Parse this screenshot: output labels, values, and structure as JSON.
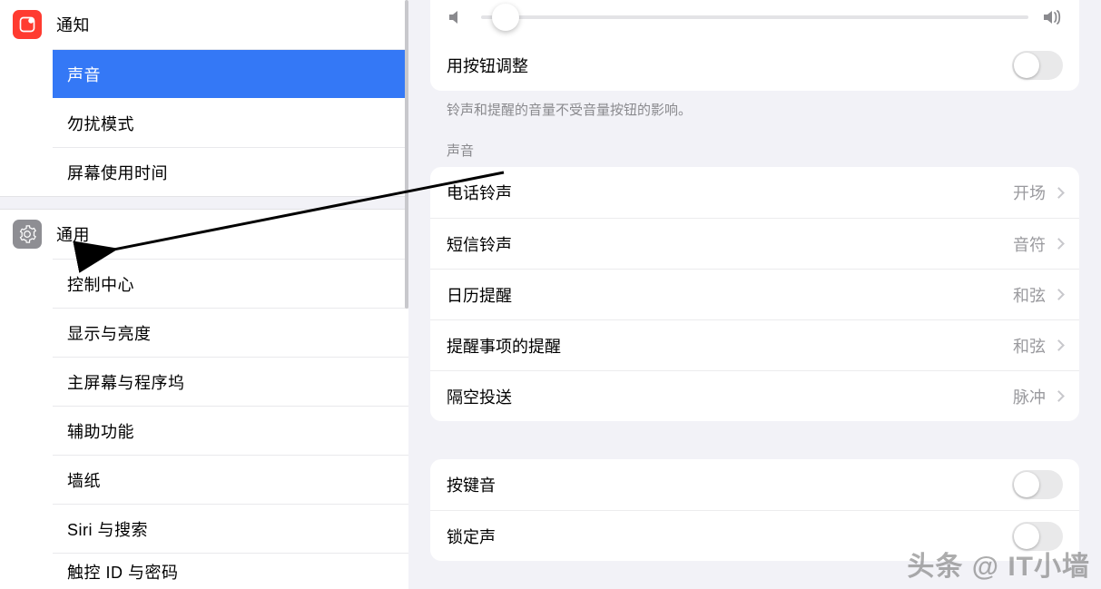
{
  "sidebar": {
    "items": [
      {
        "label": "通知",
        "icon_name": "notification-icon",
        "color": "#ff3b30"
      },
      {
        "label": "声音",
        "icon_name": "sound-icon",
        "color": "#ff3b30",
        "selected": true
      },
      {
        "label": "勿扰模式",
        "icon_name": "do-not-disturb-icon",
        "color": "#5856d6"
      },
      {
        "label": "屏幕使用时间",
        "icon_name": "screentime-icon",
        "color": "#5856d6"
      }
    ],
    "items2": [
      {
        "label": "通用",
        "icon_name": "general-icon",
        "color": "#8e8e93"
      },
      {
        "label": "控制中心",
        "icon_name": "control-center-icon",
        "color": "#8e8e93"
      },
      {
        "label": "显示与亮度",
        "icon_name": "display-icon",
        "color": "#007aff"
      },
      {
        "label": "主屏幕与程序坞",
        "icon_name": "homescreen-icon",
        "color": "#2f3cff"
      },
      {
        "label": "辅助功能",
        "icon_name": "accessibility-icon",
        "color": "#007aff"
      },
      {
        "label": "墙纸",
        "icon_name": "wallpaper-icon",
        "color": "#00b8d4"
      },
      {
        "label": "Siri 与搜索",
        "icon_name": "siri-icon",
        "color": "#1c1c1e"
      },
      {
        "label": "触控 ID 与密码",
        "icon_name": "touchid-icon",
        "color": "#ff3b30"
      }
    ]
  },
  "detail": {
    "slider": {
      "left_icon": "speaker-low-icon",
      "right_icon": "speaker-high-icon",
      "value_pct": 3
    },
    "adjust_row": {
      "label": "用按钮调整",
      "on": false
    },
    "footer1": "铃声和提醒的音量不受音量按钮的影响。",
    "group_header": "声音",
    "sounds": [
      {
        "label": "电话铃声",
        "value": "开场"
      },
      {
        "label": "短信铃声",
        "value": "音符"
      },
      {
        "label": "日历提醒",
        "value": "和弦"
      },
      {
        "label": "提醒事项的提醒",
        "value": "和弦"
      },
      {
        "label": "隔空投送",
        "value": "脉冲"
      }
    ],
    "toggles": [
      {
        "label": "按键音",
        "on": false
      },
      {
        "label": "锁定声",
        "on": false
      }
    ]
  },
  "watermark": "头条 @ IT小墙"
}
